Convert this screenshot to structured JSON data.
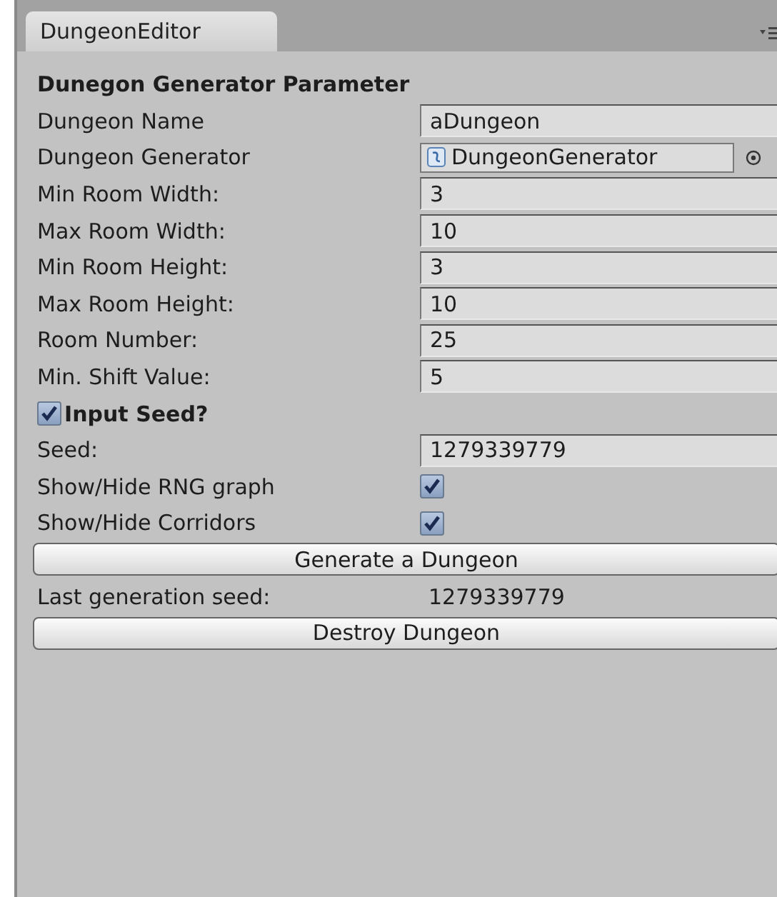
{
  "tab": {
    "label": "DungeonEditor",
    "selected": true
  },
  "header": "Dunegon Generator Parameter",
  "rows": [
    {
      "kind": "text",
      "label": "Dungeon Name",
      "value": "aDungeon"
    },
    {
      "kind": "object",
      "label": "Dungeon Generator",
      "value": "DungeonGenerator"
    },
    {
      "kind": "text",
      "label": "Min Room Width:",
      "value": "3"
    },
    {
      "kind": "text",
      "label": "Max Room Width:",
      "value": "10"
    },
    {
      "kind": "text",
      "label": "Min Room Height:",
      "value": "3"
    },
    {
      "kind": "text",
      "label": "Max Room Height:",
      "value": "10"
    },
    {
      "kind": "text",
      "label": "Room Number:",
      "value": "25"
    },
    {
      "kind": "text",
      "label": "Min. Shift Value:",
      "value": "5"
    },
    {
      "kind": "toggle",
      "label": "Input Seed?",
      "checked": true
    },
    {
      "kind": "text",
      "label": "Seed:",
      "value": "1279339779"
    },
    {
      "kind": "checkbox",
      "label": "Show/Hide RNG graph",
      "checked": true
    },
    {
      "kind": "checkbox",
      "label": "Show/Hide Corridors",
      "checked": true
    },
    {
      "kind": "button",
      "label": "Generate a Dungeon"
    },
    {
      "kind": "info",
      "label": "Last generation seed:",
      "value": "1279339779"
    },
    {
      "kind": "button",
      "label": "Destroy Dungeon"
    }
  ]
}
